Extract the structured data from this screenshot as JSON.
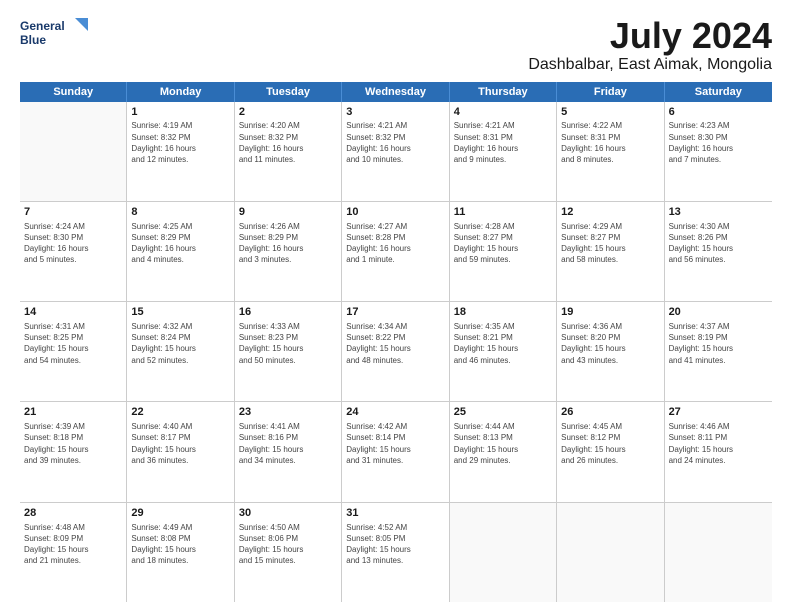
{
  "logo": {
    "line1": "General",
    "line2": "Blue"
  },
  "title": "July 2024",
  "subtitle": "Dashbalbar, East Aimak, Mongolia",
  "weekdays": [
    "Sunday",
    "Monday",
    "Tuesday",
    "Wednesday",
    "Thursday",
    "Friday",
    "Saturday"
  ],
  "weeks": [
    [
      {
        "day": "",
        "info": ""
      },
      {
        "day": "1",
        "info": "Sunrise: 4:19 AM\nSunset: 8:32 PM\nDaylight: 16 hours\nand 12 minutes."
      },
      {
        "day": "2",
        "info": "Sunrise: 4:20 AM\nSunset: 8:32 PM\nDaylight: 16 hours\nand 11 minutes."
      },
      {
        "day": "3",
        "info": "Sunrise: 4:21 AM\nSunset: 8:32 PM\nDaylight: 16 hours\nand 10 minutes."
      },
      {
        "day": "4",
        "info": "Sunrise: 4:21 AM\nSunset: 8:31 PM\nDaylight: 16 hours\nand 9 minutes."
      },
      {
        "day": "5",
        "info": "Sunrise: 4:22 AM\nSunset: 8:31 PM\nDaylight: 16 hours\nand 8 minutes."
      },
      {
        "day": "6",
        "info": "Sunrise: 4:23 AM\nSunset: 8:30 PM\nDaylight: 16 hours\nand 7 minutes."
      }
    ],
    [
      {
        "day": "7",
        "info": "Sunrise: 4:24 AM\nSunset: 8:30 PM\nDaylight: 16 hours\nand 5 minutes."
      },
      {
        "day": "8",
        "info": "Sunrise: 4:25 AM\nSunset: 8:29 PM\nDaylight: 16 hours\nand 4 minutes."
      },
      {
        "day": "9",
        "info": "Sunrise: 4:26 AM\nSunset: 8:29 PM\nDaylight: 16 hours\nand 3 minutes."
      },
      {
        "day": "10",
        "info": "Sunrise: 4:27 AM\nSunset: 8:28 PM\nDaylight: 16 hours\nand 1 minute."
      },
      {
        "day": "11",
        "info": "Sunrise: 4:28 AM\nSunset: 8:27 PM\nDaylight: 15 hours\nand 59 minutes."
      },
      {
        "day": "12",
        "info": "Sunrise: 4:29 AM\nSunset: 8:27 PM\nDaylight: 15 hours\nand 58 minutes."
      },
      {
        "day": "13",
        "info": "Sunrise: 4:30 AM\nSunset: 8:26 PM\nDaylight: 15 hours\nand 56 minutes."
      }
    ],
    [
      {
        "day": "14",
        "info": "Sunrise: 4:31 AM\nSunset: 8:25 PM\nDaylight: 15 hours\nand 54 minutes."
      },
      {
        "day": "15",
        "info": "Sunrise: 4:32 AM\nSunset: 8:24 PM\nDaylight: 15 hours\nand 52 minutes."
      },
      {
        "day": "16",
        "info": "Sunrise: 4:33 AM\nSunset: 8:23 PM\nDaylight: 15 hours\nand 50 minutes."
      },
      {
        "day": "17",
        "info": "Sunrise: 4:34 AM\nSunset: 8:22 PM\nDaylight: 15 hours\nand 48 minutes."
      },
      {
        "day": "18",
        "info": "Sunrise: 4:35 AM\nSunset: 8:21 PM\nDaylight: 15 hours\nand 46 minutes."
      },
      {
        "day": "19",
        "info": "Sunrise: 4:36 AM\nSunset: 8:20 PM\nDaylight: 15 hours\nand 43 minutes."
      },
      {
        "day": "20",
        "info": "Sunrise: 4:37 AM\nSunset: 8:19 PM\nDaylight: 15 hours\nand 41 minutes."
      }
    ],
    [
      {
        "day": "21",
        "info": "Sunrise: 4:39 AM\nSunset: 8:18 PM\nDaylight: 15 hours\nand 39 minutes."
      },
      {
        "day": "22",
        "info": "Sunrise: 4:40 AM\nSunset: 8:17 PM\nDaylight: 15 hours\nand 36 minutes."
      },
      {
        "day": "23",
        "info": "Sunrise: 4:41 AM\nSunset: 8:16 PM\nDaylight: 15 hours\nand 34 minutes."
      },
      {
        "day": "24",
        "info": "Sunrise: 4:42 AM\nSunset: 8:14 PM\nDaylight: 15 hours\nand 31 minutes."
      },
      {
        "day": "25",
        "info": "Sunrise: 4:44 AM\nSunset: 8:13 PM\nDaylight: 15 hours\nand 29 minutes."
      },
      {
        "day": "26",
        "info": "Sunrise: 4:45 AM\nSunset: 8:12 PM\nDaylight: 15 hours\nand 26 minutes."
      },
      {
        "day": "27",
        "info": "Sunrise: 4:46 AM\nSunset: 8:11 PM\nDaylight: 15 hours\nand 24 minutes."
      }
    ],
    [
      {
        "day": "28",
        "info": "Sunrise: 4:48 AM\nSunset: 8:09 PM\nDaylight: 15 hours\nand 21 minutes."
      },
      {
        "day": "29",
        "info": "Sunrise: 4:49 AM\nSunset: 8:08 PM\nDaylight: 15 hours\nand 18 minutes."
      },
      {
        "day": "30",
        "info": "Sunrise: 4:50 AM\nSunset: 8:06 PM\nDaylight: 15 hours\nand 15 minutes."
      },
      {
        "day": "31",
        "info": "Sunrise: 4:52 AM\nSunset: 8:05 PM\nDaylight: 15 hours\nand 13 minutes."
      },
      {
        "day": "",
        "info": ""
      },
      {
        "day": "",
        "info": ""
      },
      {
        "day": "",
        "info": ""
      }
    ]
  ]
}
